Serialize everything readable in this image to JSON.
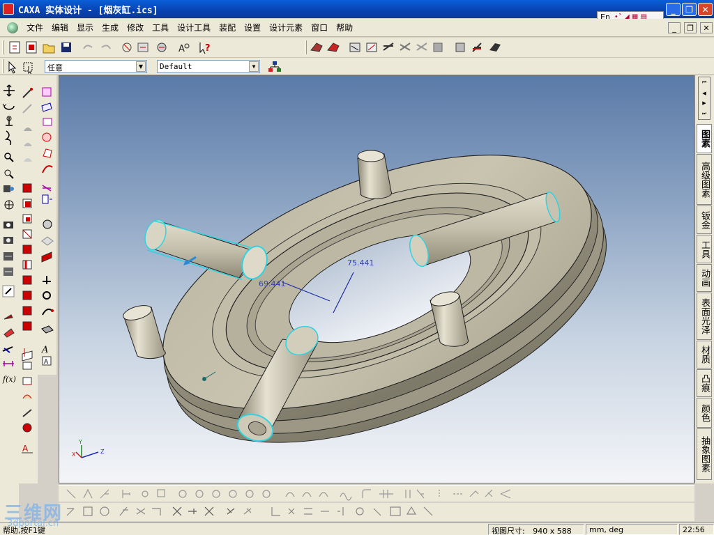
{
  "window": {
    "title": "CAXA 实体设计 - [烟灰缸.ics]",
    "ime_label": "En",
    "minimize_glyph": "_",
    "restore_glyph": "❐",
    "close_glyph": "✕"
  },
  "menu": {
    "items": [
      "文件",
      "编辑",
      "显示",
      "生成",
      "修改",
      "工具",
      "设计工具",
      "装配",
      "设置",
      "设计元素",
      "窗口",
      "帮助"
    ]
  },
  "toolbar2": {
    "filter_value": "任意",
    "style_value": "Default"
  },
  "viewport": {
    "dim1": "69.441",
    "dim2": "75.441",
    "axis_x": "X",
    "axis_y": "Y",
    "axis_z": "Z"
  },
  "right_tabs": {
    "nav_glyphs": [
      "⏮",
      "◀",
      "▶",
      "⏭"
    ],
    "items": [
      "图素",
      "高级图素",
      "钣金",
      "工具",
      "动画",
      "表面光泽",
      "材质",
      "凸痕",
      "颜色",
      "抽象图素"
    ]
  },
  "statusbar": {
    "help": "帮助,按F1键",
    "view_size_label": "视图尺寸:",
    "view_size_value": "940 x 588",
    "units": "mm, deg",
    "time": "22:56"
  },
  "watermark": {
    "logo": "三维网",
    "url": "3dportal.cn"
  },
  "colors": {
    "title_bar": "#0842b0",
    "viewport_top": "#5a7aa8",
    "viewport_bottom": "#f4f5f8",
    "part_color": "#c9c4b0",
    "selection_edge": "#2fd3e0"
  }
}
